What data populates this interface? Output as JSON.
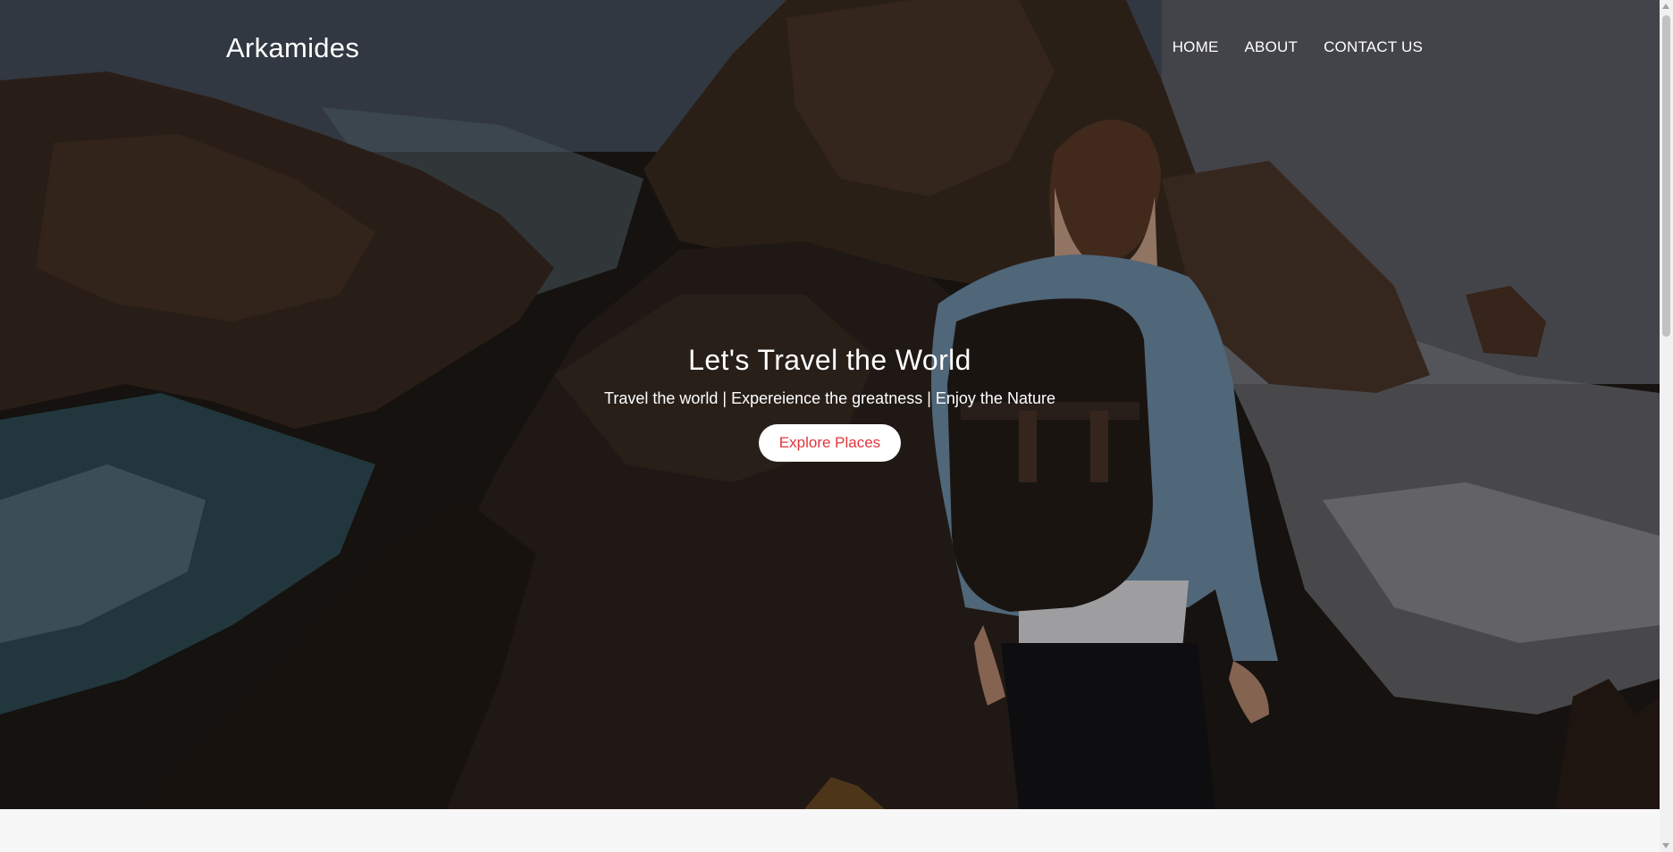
{
  "brand": {
    "name": "Arkamides"
  },
  "nav": {
    "items": [
      {
        "label": "HOME"
      },
      {
        "label": "ABOUT"
      },
      {
        "label": "CONTACT US"
      }
    ]
  },
  "hero": {
    "headline": "Let's Travel the World",
    "tagline": "Travel the world | Expereience the greatness | Enjoy the Nature",
    "cta_label": "Explore Places"
  },
  "colors": {
    "cta_text": "#e2343c",
    "cta_bg": "#ffffff",
    "nav_text": "#ffffff"
  },
  "icons": {
    "scroll_up": "scroll-up-arrow-icon",
    "scroll_down": "scroll-down-arrow-icon"
  }
}
